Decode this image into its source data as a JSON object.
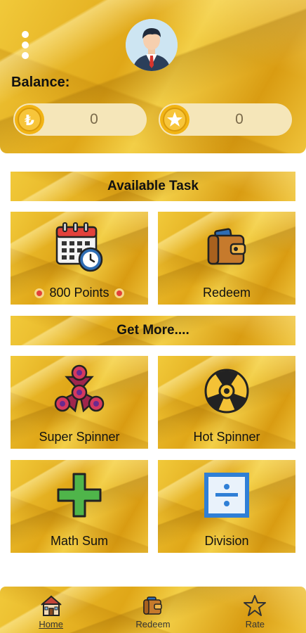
{
  "header": {
    "menu_icon": "more-vertical-icon",
    "avatar_icon": "user-avatar-icon",
    "balance_label": "Balance:",
    "balances": [
      {
        "icon": "rupee-coin-icon",
        "value": "0"
      },
      {
        "icon": "star-coin-icon",
        "value": "0"
      }
    ]
  },
  "sections": {
    "available_task": "Available Task",
    "get_more": "Get More...."
  },
  "tasks": [
    {
      "label": "800 Points",
      "icon": "calendar-clock-icon"
    },
    {
      "label": "Redeem",
      "icon": "wallet-icon"
    }
  ],
  "more": [
    {
      "label": "Super Spinner",
      "icon": "fidget-spinner-icon"
    },
    {
      "label": "Hot Spinner",
      "icon": "hot-spinner-icon"
    },
    {
      "label": "Math Sum",
      "icon": "plus-icon"
    },
    {
      "label": "Division",
      "icon": "division-icon"
    }
  ],
  "bottom_nav": [
    {
      "label": "Home",
      "icon": "home-icon",
      "active": true
    },
    {
      "label": "Redeem",
      "icon": "wallet-icon"
    },
    {
      "label": "Rate",
      "icon": "star-outline-icon"
    }
  ],
  "colors": {
    "gold": "#e3ad1c",
    "pill": "#f5e6b9",
    "coin": "#f2b414"
  }
}
